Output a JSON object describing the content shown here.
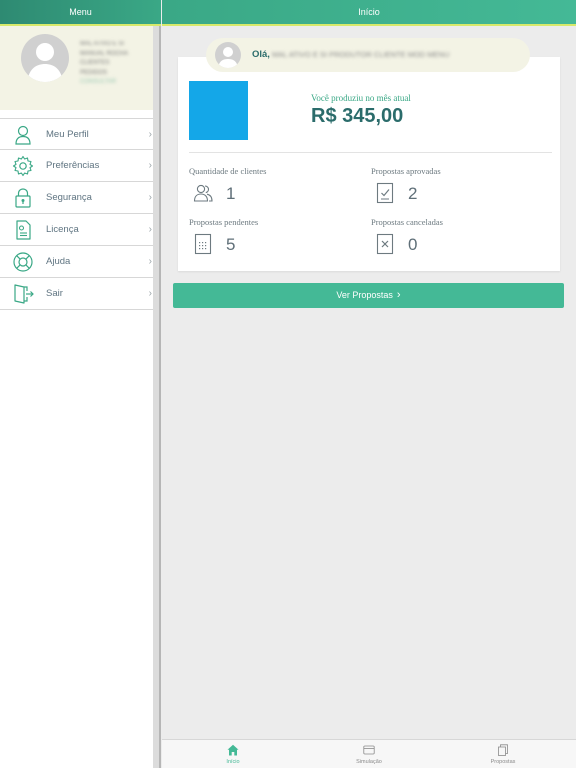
{
  "colors": {
    "accent": "#44b996",
    "accent_dark": "#2b6c6b",
    "blue_tile": "#14a7e8",
    "header_underline": "#d8e96a"
  },
  "menu": {
    "title": "Menu",
    "profile": {
      "avatar_icon": "user-avatar-icon",
      "blurred_lines": [
        "MAL ATIVO E SI",
        "MANUAL ROCHA",
        "CLIENTES",
        "PEDIDOS",
        "CONSULTAR"
      ]
    },
    "items": [
      {
        "label": "Meu Perfil",
        "icon": "user-icon"
      },
      {
        "label": "Preferências",
        "icon": "gear-icon"
      },
      {
        "label": "Segurança",
        "icon": "lock-icon"
      },
      {
        "label": "Licença",
        "icon": "license-icon"
      },
      {
        "label": "Ajuda",
        "icon": "lifebuoy-icon"
      },
      {
        "label": "Sair",
        "icon": "exit-icon"
      }
    ]
  },
  "main": {
    "title": "Início",
    "greeting": {
      "hello": "Olá,",
      "name_blurred": "MAL ATIVO E SI PRODUTOR CLIENTE MOD MENU LTDA"
    },
    "summary": {
      "produced_label": "Você produziu no mês atual",
      "produced_value": "R$ 345,00",
      "stats": [
        {
          "label": "Quantidade de clientes",
          "value": "1",
          "icon": "users-icon"
        },
        {
          "label": "Propostas aprovadas",
          "value": "2",
          "icon": "approved-doc-icon"
        },
        {
          "label": "Propostas pendentes",
          "value": "5",
          "icon": "pending-doc-icon"
        },
        {
          "label": "Propostas canceladas",
          "value": "0",
          "icon": "cancelled-doc-icon"
        }
      ]
    },
    "cta_label": "Ver Propostas"
  },
  "tabbar": {
    "tabs": [
      {
        "label": "Início",
        "icon": "home-icon",
        "active": true
      },
      {
        "label": "Simulação",
        "icon": "card-icon",
        "active": false
      },
      {
        "label": "Propostas",
        "icon": "documents-icon",
        "active": false
      }
    ]
  }
}
